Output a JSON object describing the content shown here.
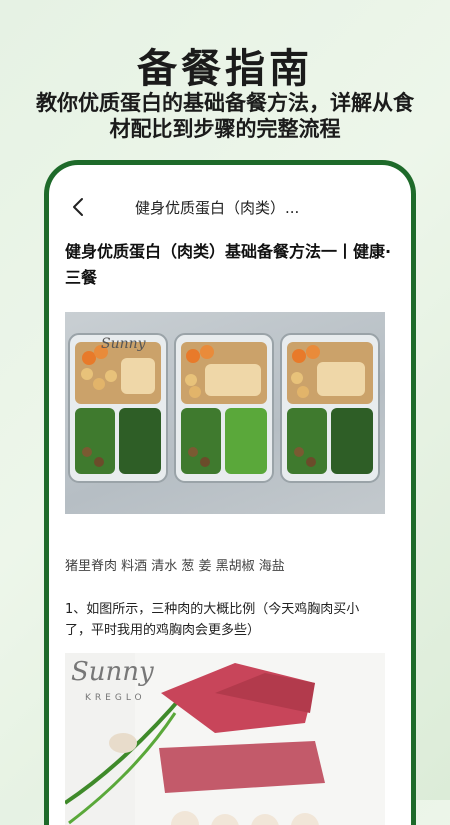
{
  "hero": {
    "title": "备餐指南",
    "subtitle": "教你优质蛋白的基础备餐方法，详解从食材配比到步骤的完整流程"
  },
  "nav": {
    "title": "健身优质蛋白（肉类）...",
    "back_icon": "chevron-left-icon"
  },
  "article": {
    "title": "健身优质蛋白（肉类）基础备餐方法一丨健康·三餐",
    "ingredients": "猪里脊肉 料酒 清水 葱 姜 黑胡椒 海盐",
    "step_text": "1、如图所示，三种肉的大概比例（今天鸡胸肉买小了，平时我用的鸡胸肉会更多些）"
  },
  "images": {
    "meal_prep_watermark": "Sunny",
    "meat_watermark": "Sunny",
    "meat_watermark_sub": "KREGLO"
  },
  "colors": {
    "phone_frame": "#1e6a2a",
    "background": "#e6f2e4"
  }
}
